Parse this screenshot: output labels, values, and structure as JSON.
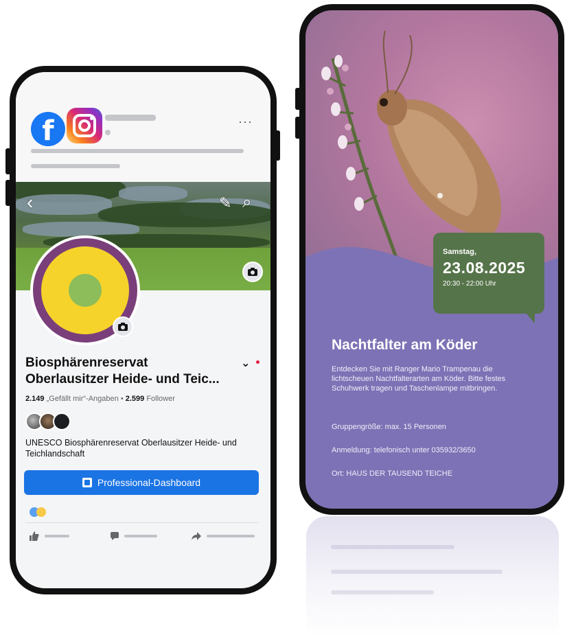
{
  "left_phone": {
    "header": {
      "more_glyph": "···"
    },
    "cover": {
      "back_glyph": "‹",
      "edit_glyph": "✎",
      "search_glyph": "⌕"
    },
    "page": {
      "name_line1": "Biosphärenreservat",
      "name_line2": "Oberlausitzer Heide- und Teic...",
      "chevron": "⌄",
      "likes_count": "2.149",
      "likes_label": "„Gefällt mir“-Angaben",
      "separator": "•",
      "followers_count": "2.599",
      "followers_label": "Follower",
      "description": "UNESCO Biosphärenreservat Oberlausitzer Heide- und Teichlandschaft",
      "dashboard_button": "Professional-Dashboard"
    },
    "colors": {
      "facebook_blue": "#1877f2",
      "avatar_ring": "#7a3f7a",
      "avatar_yellow": "#f6d32a",
      "avatar_green": "#8dbd5a",
      "button_blue": "#1b74e4"
    }
  },
  "right_phone": {
    "event": {
      "day": "Samstag,",
      "date": "23.08.2025",
      "time": "20:30 - 22:00 Uhr",
      "title": "Nachtfalter am Köder",
      "description": "Entdecken Sie mit Ranger Mario Trampenau die lichtscheuen Nachtfalterarten am Köder. Bitte festes Schuhwerk tragen und Taschenlampe mitbringen.",
      "group_size": "Gruppengröße: max. 15 Personen",
      "registration": "Anmeldung: telefonisch unter 035932/3650",
      "location": "Ort: HAUS DER TAUSEND TEICHE"
    },
    "colors": {
      "background": "#7d72b5",
      "date_box": "#56744a"
    }
  }
}
